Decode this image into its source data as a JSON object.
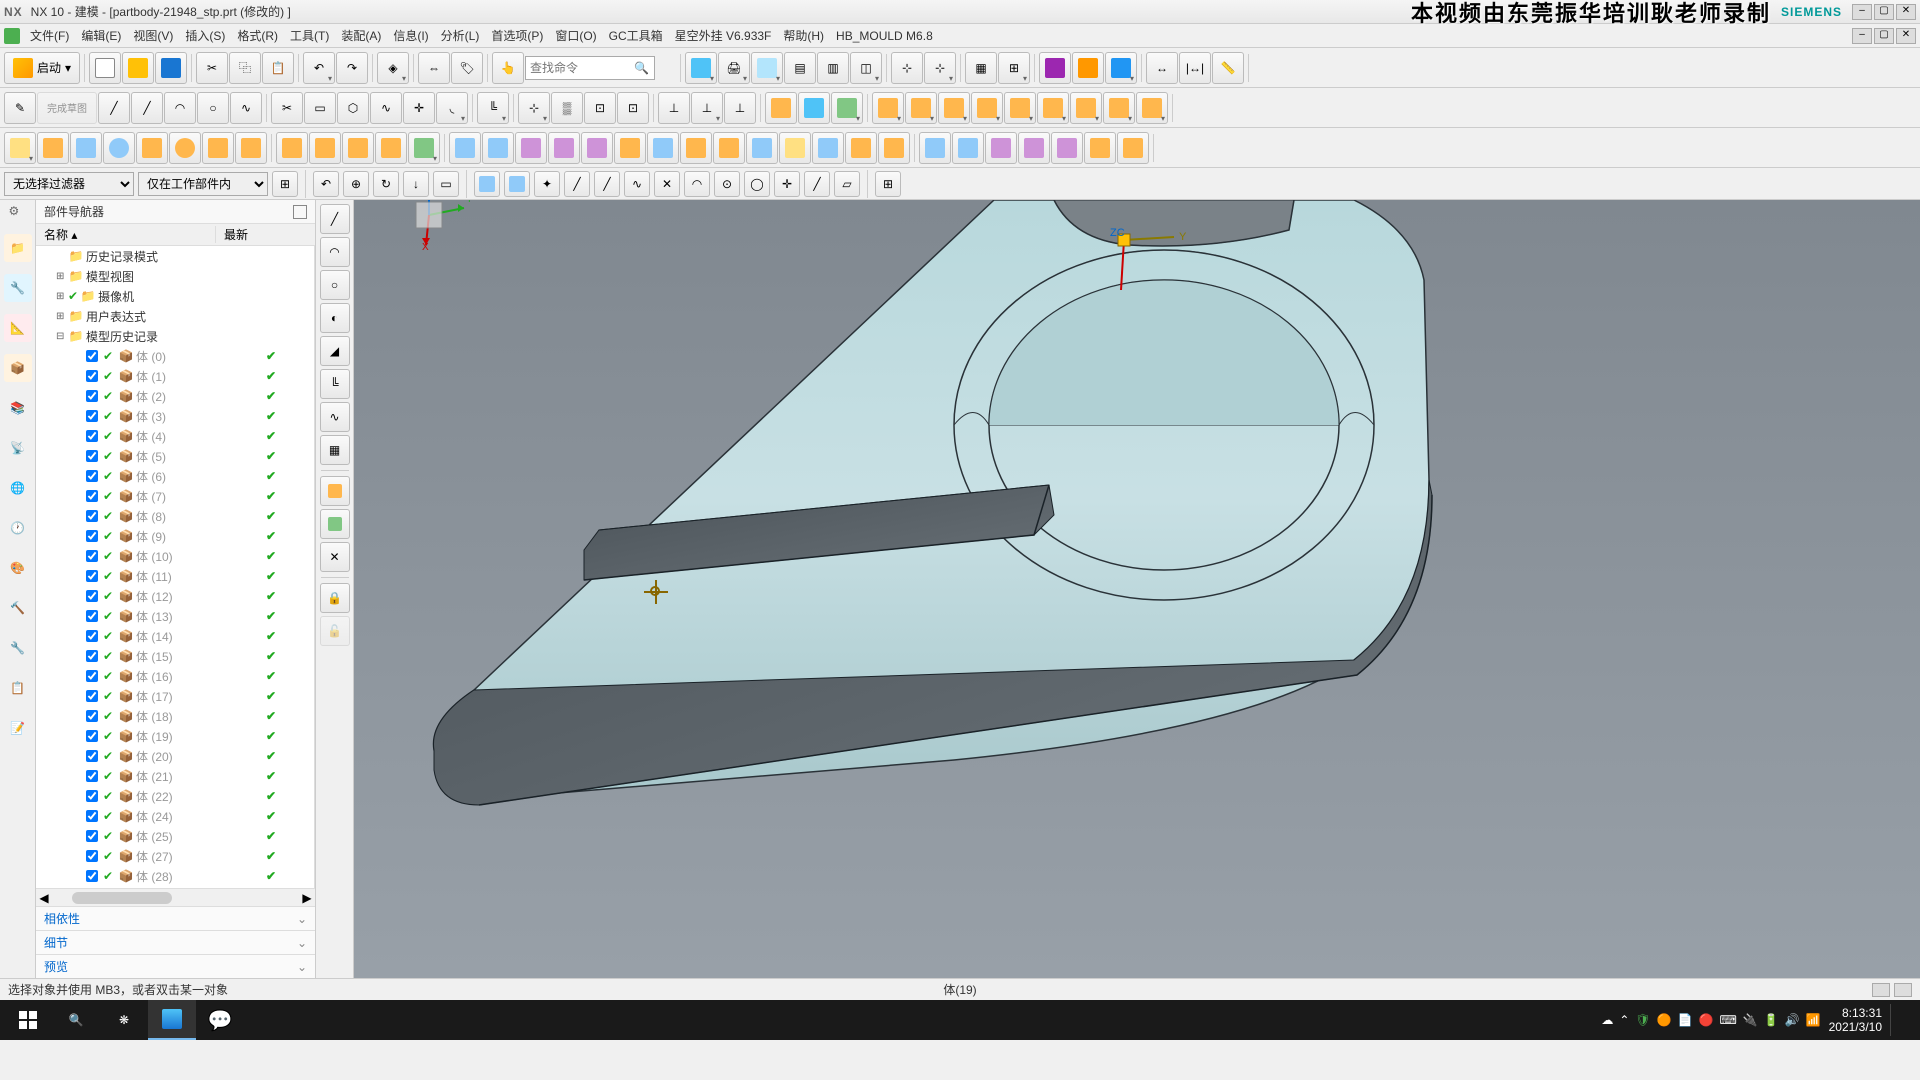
{
  "title": {
    "app": "NX 10",
    "mode": "建模",
    "file": "[partbody-21948_stp.prt",
    "status": "(修改的)  ]"
  },
  "watermark": "本视频由东莞振华培训耿老师录制",
  "brand": "SIEMENS",
  "menu": [
    "文件(F)",
    "编辑(E)",
    "视图(V)",
    "插入(S)",
    "格式(R)",
    "工具(T)",
    "装配(A)",
    "信息(I)",
    "分析(L)",
    "首选项(P)",
    "窗口(O)",
    "GC工具箱",
    "星空外挂 V6.933F",
    "帮助(H)",
    "HB_MOULD M6.8"
  ],
  "start_label": "启动",
  "search_placeholder": "查找命令",
  "filters": {
    "selection_filter": "无选择过滤器",
    "scope_filter": "仅在工作部件内"
  },
  "navigator": {
    "title": "部件导航器",
    "col_name": "名称",
    "col_latest": "最新",
    "top_items": [
      {
        "label": "历史记录模式",
        "icon": "history"
      },
      {
        "label": "模型视图",
        "icon": "views",
        "expand": "+"
      },
      {
        "label": "摄像机",
        "icon": "camera",
        "check": true,
        "expand": "+"
      },
      {
        "label": "用户表达式",
        "icon": "expr",
        "expand": "+"
      },
      {
        "label": "模型历史记录",
        "icon": "folder",
        "expand": "-"
      }
    ],
    "bodies": [
      {
        "idx": 0
      },
      {
        "idx": 1
      },
      {
        "idx": 2
      },
      {
        "idx": 3
      },
      {
        "idx": 4
      },
      {
        "idx": 5
      },
      {
        "idx": 6
      },
      {
        "idx": 7
      },
      {
        "idx": 8
      },
      {
        "idx": 9
      },
      {
        "idx": 10
      },
      {
        "idx": 11
      },
      {
        "idx": 12
      },
      {
        "idx": 13
      },
      {
        "idx": 14
      },
      {
        "idx": 15
      },
      {
        "idx": 16
      },
      {
        "idx": 17
      },
      {
        "idx": 18
      },
      {
        "idx": 19
      },
      {
        "idx": 20
      },
      {
        "idx": 21
      },
      {
        "idx": 22
      },
      {
        "idx": 24
      },
      {
        "idx": 25
      },
      {
        "idx": 27
      },
      {
        "idx": 28
      }
    ],
    "body_prefix": "体",
    "sections": [
      "相依性",
      "细节",
      "预览"
    ]
  },
  "status": {
    "prompt": "选择对象并使用 MB3，或者双击某一对象",
    "selection": "体(19)"
  },
  "tray": {
    "time": "8:13:31",
    "date": "2021/3/10"
  },
  "triad": {
    "x": "X",
    "y": "Y",
    "z": "Z"
  }
}
